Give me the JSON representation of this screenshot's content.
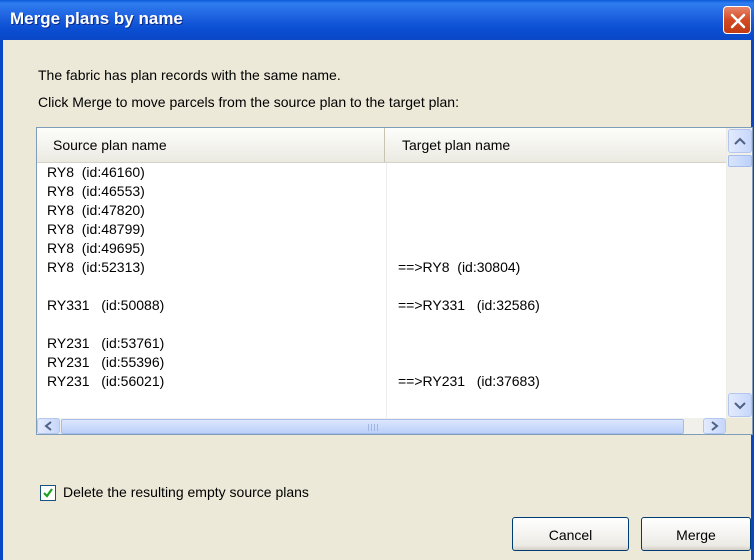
{
  "window": {
    "title": "Merge plans by name"
  },
  "description": {
    "line1": "The fabric has plan records with the same name.",
    "line2": "Click Merge to move parcels from the source plan to the target plan:"
  },
  "table": {
    "columns": [
      "Source plan name",
      "Target plan name"
    ],
    "rows": [
      {
        "source": "RY8  (id:46160)",
        "target": ""
      },
      {
        "source": "RY8  (id:46553)",
        "target": ""
      },
      {
        "source": "RY8  (id:47820)",
        "target": ""
      },
      {
        "source": "RY8  (id:48799)",
        "target": ""
      },
      {
        "source": "RY8  (id:49695)",
        "target": ""
      },
      {
        "source": "RY8  (id:52313)",
        "target": "==>RY8  (id:30804)"
      },
      {
        "source": "",
        "target": ""
      },
      {
        "source": "RY331   (id:50088)",
        "target": "==>RY331   (id:32586)"
      },
      {
        "source": "",
        "target": ""
      },
      {
        "source": "RY231   (id:53761)",
        "target": ""
      },
      {
        "source": "RY231   (id:55396)",
        "target": ""
      },
      {
        "source": "RY231   (id:56021)",
        "target": "==>RY231   (id:37683)"
      }
    ]
  },
  "options": {
    "delete_empty_label": "Delete the resulting empty source plans",
    "delete_empty_checked": true
  },
  "buttons": {
    "cancel": "Cancel",
    "merge": "Merge"
  }
}
